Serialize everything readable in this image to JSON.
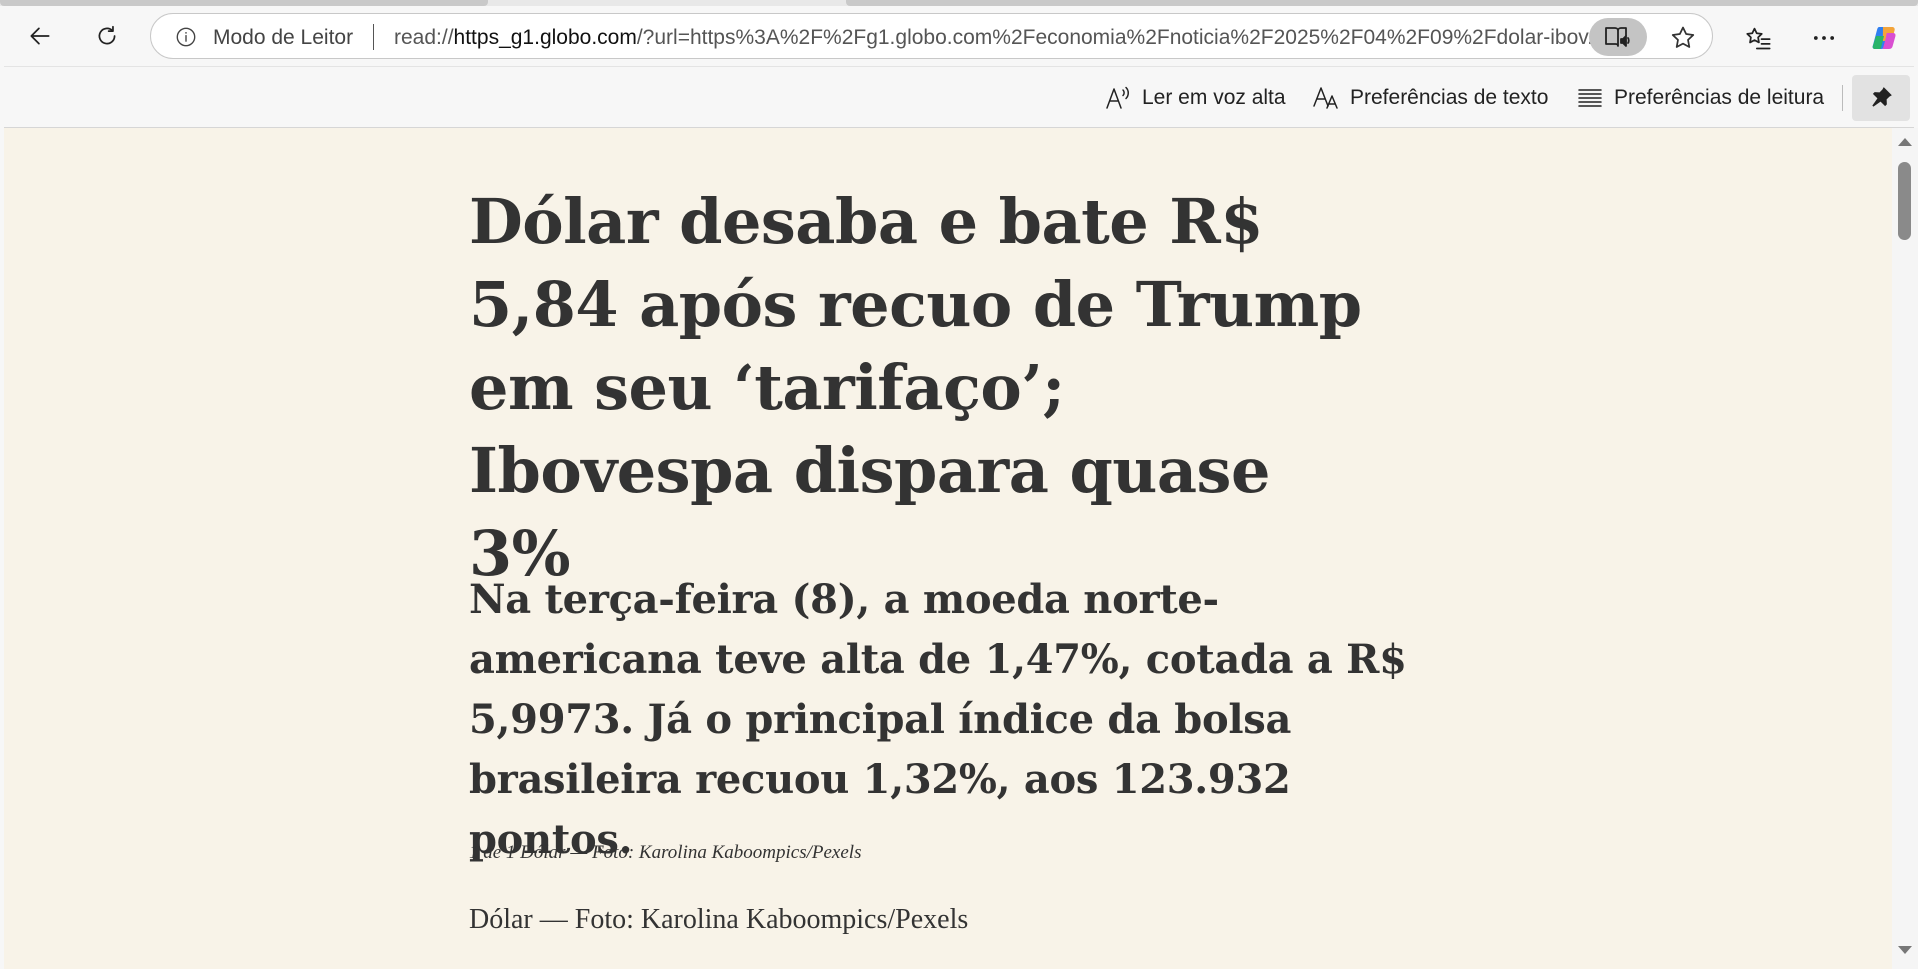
{
  "browser": {
    "omnibox": {
      "reader_mode_label": "Modo de Leitor",
      "url_prefix": "read://",
      "url_host": "https_g1.globo.com",
      "url_rest": "/?url=https%3A%2F%2Fg1.globo.com%2Feconomia%2Fnoticia%2F2025%2F04%2F09%2Fdolar-ibov..."
    },
    "icons": {
      "back": "back-arrow-icon",
      "reload": "reload-icon",
      "info": "info-icon",
      "immersive_reader": "immersive-reader-icon",
      "favorite": "star-icon",
      "favorites": "favorites-list-icon",
      "more": "more-icon",
      "copilot": "copilot-icon"
    }
  },
  "reader_toolbar": {
    "read_aloud": "Ler em voz alta",
    "text_prefs": "Preferências de texto",
    "reading_prefs": "Preferências de leitura"
  },
  "article": {
    "headline": "Dólar desaba e bate R$ 5,84 após recuo de Trump em seu ‘tarifaço’; Ibovespa dispara quase 3%",
    "lede": "Na terça-feira (8), a moeda norte-americana teve alta de 1,47%, cotada a R$ 5,9973. Já o principal índice da bolsa brasileira recuou 1,32%, aos 123.932 pontos.",
    "caption": "1 de 1 Dólar — Foto: Karolina Kaboompics/Pexels",
    "credit": "Dólar — Foto: Karolina Kaboompics/Pexels"
  },
  "colors": {
    "reader_background": "#f8f3e8",
    "text": "#333333",
    "chrome_background": "#f7f7f7"
  }
}
